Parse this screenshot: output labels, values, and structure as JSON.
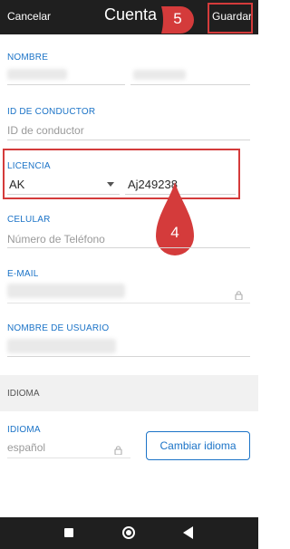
{
  "topbar": {
    "cancel": "Cancelar",
    "title": "Cuenta",
    "save": "Guardar"
  },
  "annotations": {
    "step_save": "5",
    "step_license": "4"
  },
  "fields": {
    "nombre": {
      "label": "NOMBRE"
    },
    "driver_id": {
      "label": "ID DE CONDUCTOR",
      "placeholder": "ID de conductor"
    },
    "licencia": {
      "label": "LICENCIA",
      "state": "AK",
      "number": "Aj249238"
    },
    "celular": {
      "label": "CELULAR",
      "placeholder": "Número de Teléfono"
    },
    "email": {
      "label": "E-MAIL"
    },
    "usuario": {
      "label": "NOMBRE DE USUARIO"
    }
  },
  "section": {
    "title": "IDIOMA"
  },
  "language": {
    "label": "IDIOMA",
    "value": "español",
    "button": "Cambiar idioma"
  },
  "colors": {
    "accent": "#1b73c7",
    "highlight": "#d43b3b",
    "bars": "#1f1f1f"
  },
  "icons": [
    "lock-icon",
    "dropdown-arrow-icon",
    "recents-icon",
    "home-icon",
    "back-icon"
  ]
}
